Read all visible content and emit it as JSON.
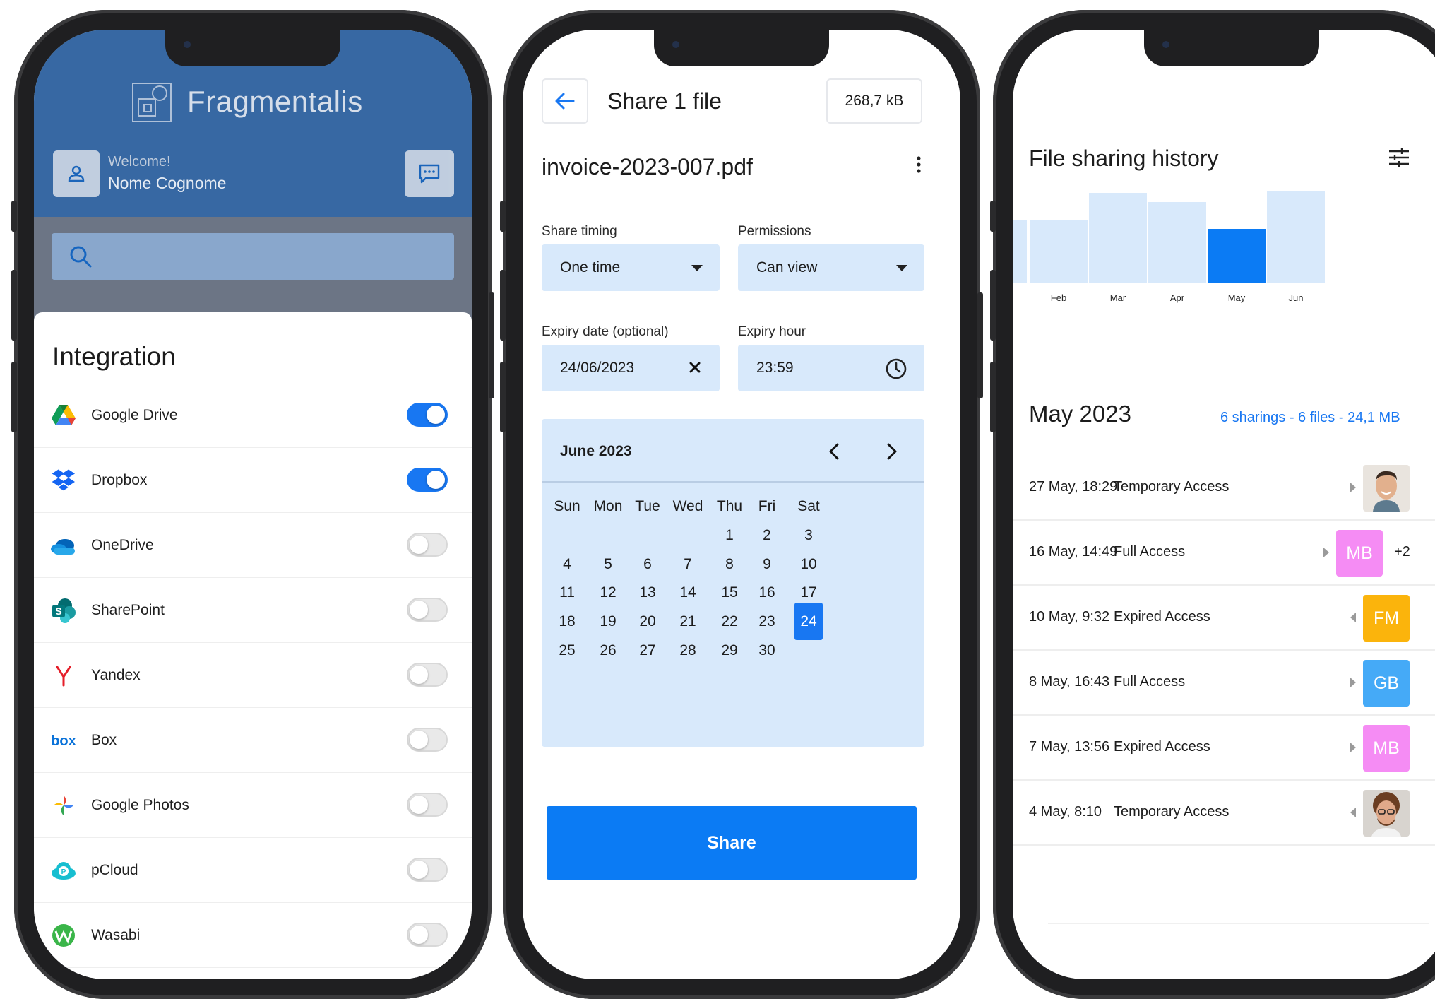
{
  "phone1": {
    "app_title": "Fragmentalis",
    "welcome": "Welcome!",
    "username": "Nome Cognome",
    "sheet_title": "Integration",
    "integrations": [
      {
        "label": "Google Drive",
        "icon": "google-drive-icon",
        "enabled": true
      },
      {
        "label": "Dropbox",
        "icon": "dropbox-icon",
        "enabled": true
      },
      {
        "label": "OneDrive",
        "icon": "onedrive-icon",
        "enabled": false
      },
      {
        "label": "SharePoint",
        "icon": "sharepoint-icon",
        "enabled": false
      },
      {
        "label": "Yandex",
        "icon": "yandex-icon",
        "enabled": false
      },
      {
        "label": "Box",
        "icon": "box-icon",
        "enabled": false
      },
      {
        "label": "Google Photos",
        "icon": "google-photos-icon",
        "enabled": false
      },
      {
        "label": "pCloud",
        "icon": "pcloud-icon",
        "enabled": false
      },
      {
        "label": "Wasabi",
        "icon": "wasabi-icon",
        "enabled": false
      }
    ],
    "colors": {
      "header": "#1565c0",
      "toggle_on": "#1877f2"
    }
  },
  "phone2": {
    "title": "Share 1 file",
    "file_size": "268,7 kB",
    "file_name": "invoice-2023-007.pdf",
    "share_timing_label": "Share timing",
    "share_timing_value": "One time",
    "permissions_label": "Permissions",
    "permissions_value": "Can view",
    "expiry_date_label": "Expiry date (optional)",
    "expiry_date_value": "24/06/2023",
    "expiry_hour_label": "Expiry hour",
    "expiry_hour_value": "23:59",
    "calendar": {
      "month": "June 2023",
      "weekdays": [
        "Sun",
        "Mon",
        "Tue",
        "Wed",
        "Thu",
        "Fri",
        "Sat"
      ],
      "first_weekday_index": 4,
      "days_in_month": 30,
      "selected_day": 24
    },
    "share_button": "Share",
    "colors": {
      "field_bg": "#d8e9fb",
      "primary": "#0b7bf4"
    }
  },
  "phone3": {
    "title": "File sharing history",
    "chart_data": {
      "type": "bar",
      "categories": [
        "Feb",
        "Mar",
        "Apr",
        "May",
        "Jun"
      ],
      "values": [
        88,
        127,
        114,
        76,
        152
      ],
      "highlighted": "May",
      "colors": {
        "bar": "#d8e9fb",
        "highlight": "#0b7bf4"
      },
      "grid": false
    },
    "month_title": "May 2023",
    "month_summary": "6 sharings - 6 files - 24,1 MB",
    "history": [
      {
        "date": "27 May, 18:29",
        "access": "Temporary Access",
        "avatar_type": "photo",
        "avatar_name": "person-photo-1",
        "arrow": "right"
      },
      {
        "date": "16 May, 14:49",
        "access": "Full Access",
        "avatar_type": "initials",
        "initials": "MB",
        "color": "#f58cf4",
        "extra": "+2",
        "arrow": "right"
      },
      {
        "date": "10 May, 9:32",
        "access": "Expired Access",
        "avatar_type": "initials",
        "initials": "FM",
        "color": "#fbb40c",
        "arrow": "left"
      },
      {
        "date": "8 May, 16:43",
        "access": "Full Access",
        "avatar_type": "initials",
        "initials": "GB",
        "color": "#45aaf7",
        "arrow": "right"
      },
      {
        "date": "7 May, 13:56",
        "access": "Expired Access",
        "avatar_type": "initials",
        "initials": "MB",
        "color": "#f58cf4",
        "arrow": "right"
      },
      {
        "date": "4 May, 8:10",
        "access": "Temporary Access",
        "avatar_type": "photo",
        "avatar_name": "person-photo-2",
        "arrow": "left"
      }
    ]
  }
}
